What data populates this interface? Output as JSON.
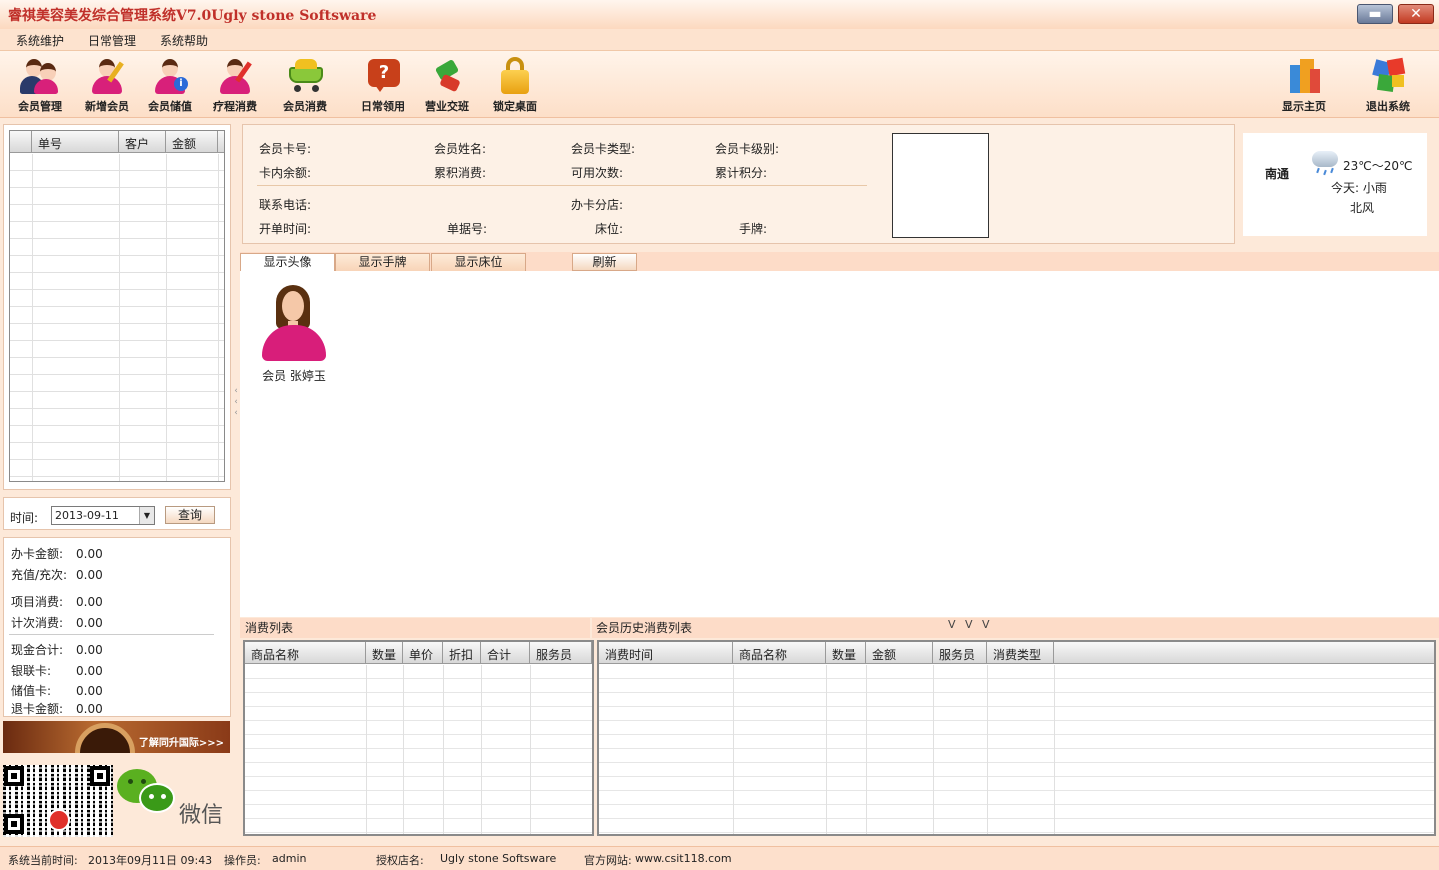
{
  "window": {
    "title": "睿祺美容美发综合管理系统V7.0Ugly  stone Softsware",
    "min_symbol": "▬",
    "close_symbol": "✕"
  },
  "menu": [
    "系统维护",
    "日常管理",
    "系统帮助"
  ],
  "toolbar": {
    "items": [
      {
        "label": "会员管理",
        "icon": "members-icon"
      },
      {
        "label": "新增会员",
        "icon": "add-member-icon"
      },
      {
        "label": "会员储值",
        "icon": "member-deposit-icon"
      },
      {
        "label": "疗程消费",
        "icon": "treatment-icon"
      },
      {
        "label": "会员消费",
        "icon": "shopping-cart-icon"
      },
      {
        "label": "日常领用",
        "icon": "question-icon"
      },
      {
        "label": "营业交班",
        "icon": "handover-arrow-icon"
      },
      {
        "label": "锁定桌面",
        "icon": "lock-icon"
      }
    ],
    "right_items": [
      {
        "label": "显示主页",
        "icon": "home-blocks-icon"
      },
      {
        "label": "退出系统",
        "icon": "exit-puzzle-icon"
      }
    ]
  },
  "orders_grid": {
    "columns": [
      "单号",
      "客户",
      "金额"
    ]
  },
  "time_query": {
    "label": "时间:",
    "date": "2013-09-11",
    "button": "查询"
  },
  "stats": [
    {
      "label": "办卡金额:",
      "value": "0.00"
    },
    {
      "label": "充值/充次:",
      "value": "0.00"
    },
    {
      "label": "项目消费:",
      "value": "0.00"
    },
    {
      "label": "计次消费:",
      "value": "0.00"
    },
    {
      "label": "现金合计:",
      "value": "0.00"
    },
    {
      "label": "银联卡:",
      "value": "0.00"
    },
    {
      "label": "储值卡:",
      "value": "0.00"
    },
    {
      "label": "退卡金额:",
      "value": "0.00"
    }
  ],
  "banner": {
    "text": "了解同升国际>>>"
  },
  "wechat": {
    "label": "微信"
  },
  "member_info": {
    "card_no": "会员卡号:",
    "name": "会员姓名:",
    "card_type": "会员卡类型:",
    "card_level": "会员卡级别:",
    "balance": "卡内余额:",
    "total_spent": "累积消费:",
    "times_left": "可用次数:",
    "points": "累计积分:",
    "phone": "联系电话:",
    "branch": "办卡分店:",
    "open_time": "开单时间:",
    "doc_no": "单据号:",
    "bed": "床位:",
    "tag": "手牌:"
  },
  "weather": {
    "city": "南通",
    "temp": "23℃～20℃",
    "today": "今天: 小雨",
    "wind": "北风"
  },
  "tabs": [
    "显示头像",
    "显示手牌",
    "显示床位"
  ],
  "refresh_button": "刷新",
  "member_card": {
    "name": "会员 张婷玉"
  },
  "consume_list": {
    "title": "消费列表",
    "columns": [
      "商品名称",
      "数量",
      "单价",
      "折扣",
      "合计",
      "服务员"
    ]
  },
  "history_list": {
    "title": "会员历史消费列表",
    "arrows": "V V V",
    "columns": [
      "消费时间",
      "商品名称",
      "数量",
      "金额",
      "服务员",
      "消费类型"
    ]
  },
  "statusbar": {
    "time_label": "系统当前时间:",
    "time_value": "2013年09月11日 09:43",
    "operator_label": "操作员:",
    "operator_value": "admin",
    "shop_label": "授权店名:",
    "shop_value": "Ugly  stone Softsware",
    "site_label": "官方网站:",
    "site_value": "www.csit118.com"
  },
  "colors": {
    "accent": "#c0302a",
    "panel": "#fde9d9",
    "member_pink": "#d81e7a"
  }
}
